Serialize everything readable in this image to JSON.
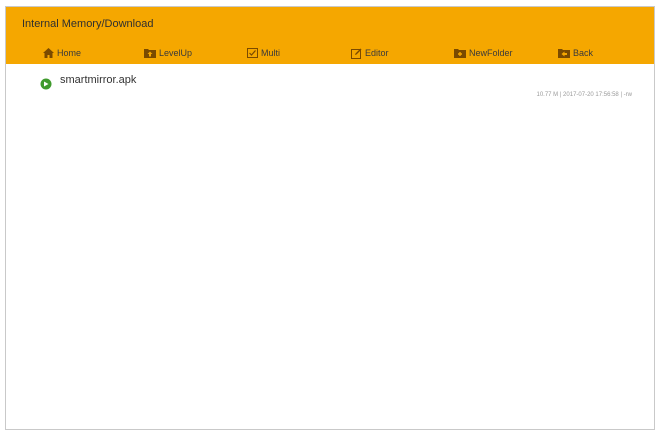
{
  "header": {
    "path": "Internal Memory/Download",
    "color": "#f5a700"
  },
  "toolbar": [
    {
      "label": "Home",
      "icon": "home-icon"
    },
    {
      "label": "LevelUp",
      "icon": "folder-up-icon"
    },
    {
      "label": "Multi",
      "icon": "multi-select-icon"
    },
    {
      "label": "Editor",
      "icon": "edit-icon"
    },
    {
      "label": "NewFolder",
      "icon": "new-folder-icon"
    },
    {
      "label": "Back",
      "icon": "back-folder-icon"
    }
  ],
  "files": [
    {
      "name": "smartmirror.apk",
      "meta": "10.77 M | 2017-07-20 17:56:58 | -rw",
      "icon": "apk-file-icon"
    }
  ]
}
